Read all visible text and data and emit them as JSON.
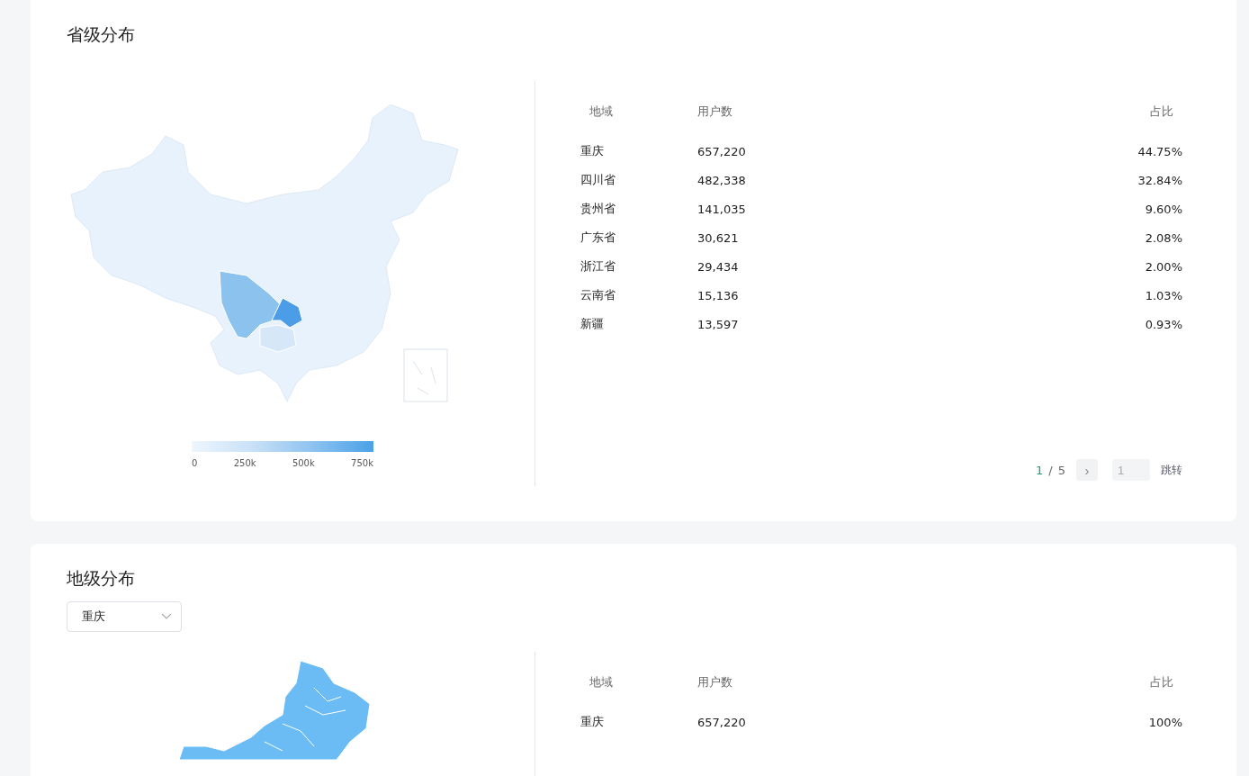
{
  "sections": [
    {
      "title": "省级分布",
      "columns": [
        "地域",
        "用户数",
        "占比"
      ],
      "kind": "country",
      "legend": {
        "ticks": [
          "0",
          "250k",
          "500k",
          "750k"
        ]
      },
      "rows": [
        {
          "region": "重庆",
          "users": "657,220",
          "share": "44.75%"
        },
        {
          "region": "四川省",
          "users": "482,338",
          "share": "32.84%"
        },
        {
          "region": "贵州省",
          "users": "141,035",
          "share": "9.60%"
        },
        {
          "region": "广东省",
          "users": "30,621",
          "share": "2.08%"
        },
        {
          "region": "浙江省",
          "users": "29,434",
          "share": "2.00%"
        },
        {
          "region": "云南省",
          "users": "15,136",
          "share": "1.03%"
        },
        {
          "region": "新疆",
          "users": "13,597",
          "share": "0.93%"
        }
      ],
      "pagination": {
        "current": "1",
        "separator": "/",
        "total": "5",
        "next": "›",
        "jump_placeholder": "1",
        "jump_label": "跳转"
      }
    },
    {
      "title": "地级分布",
      "dropdown": {
        "value": "重庆"
      },
      "columns": [
        "地域",
        "用户数",
        "占比"
      ],
      "kind": "city",
      "rows": [
        {
          "region": "重庆",
          "users": "657,220",
          "share": "100%"
        }
      ]
    }
  ]
}
